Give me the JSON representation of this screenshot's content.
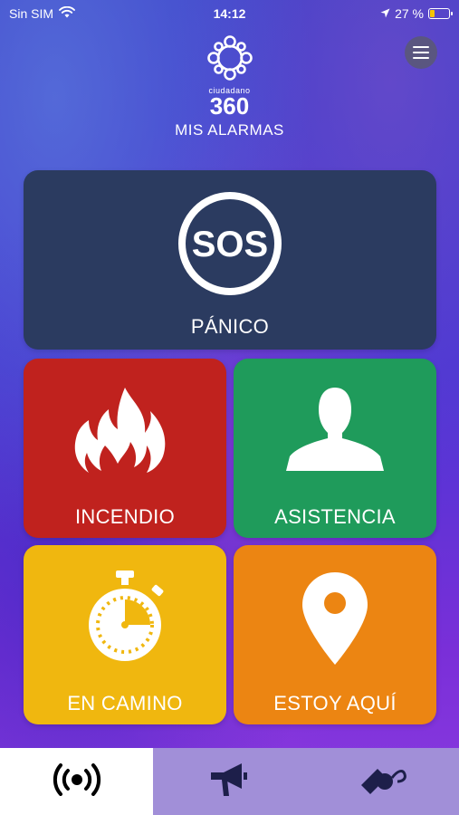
{
  "status_bar": {
    "carrier": "Sin SIM",
    "time": "14:12",
    "battery_text": "27 %",
    "battery_level": 0.27,
    "battery_color": "#f5c400"
  },
  "header": {
    "logo_word": "ciudadano",
    "logo_number": "360",
    "title": "MIS ALARMAS",
    "menu_icon": "hamburger-icon"
  },
  "tiles": {
    "panic": {
      "label": "PÁNICO",
      "icon": "sos-icon",
      "sos_text": "SOS",
      "color": "#2b3b60"
    },
    "fire": {
      "label": "INCENDIO",
      "icon": "fire-icon",
      "color": "#c0221e"
    },
    "assist": {
      "label": "ASISTENCIA",
      "icon": "person-icon",
      "color": "#1f9b5b"
    },
    "on_way": {
      "label": "EN CAMINO",
      "icon": "stopwatch-icon",
      "color": "#f0b70f"
    },
    "here": {
      "label": "ESTOY AQUÍ",
      "icon": "location-pin-icon",
      "color": "#ec8512"
    }
  },
  "tabbar": {
    "tabs": [
      {
        "icon": "broadcast-icon",
        "active": true
      },
      {
        "icon": "megaphone-icon",
        "active": false
      },
      {
        "icon": "whistle-icon",
        "active": false
      }
    ]
  }
}
